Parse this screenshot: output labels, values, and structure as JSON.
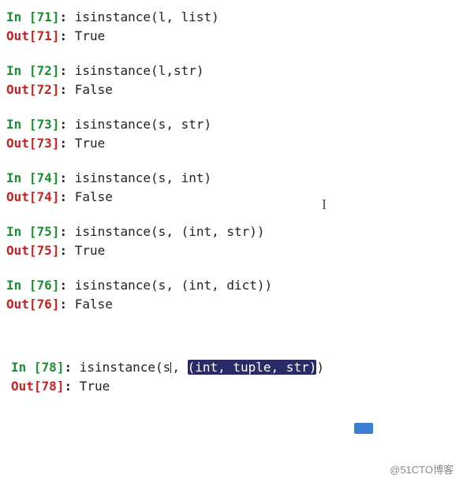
{
  "cells": [
    {
      "num": "71",
      "code": "isinstance(l, list)",
      "out": "True"
    },
    {
      "num": "72",
      "code": "isinstance(l,str)",
      "out": "False"
    },
    {
      "num": "73",
      "code": "isinstance(s, str)",
      "out": "True"
    },
    {
      "num": "74",
      "code": "isinstance(s, int)",
      "out": "False"
    },
    {
      "num": "75",
      "code": "isinstance(s, (int, str))",
      "out": "True"
    },
    {
      "num": "76",
      "code": "isinstance(s, (int, dict))",
      "out": "False"
    }
  ],
  "cell78": {
    "num": "78",
    "code_prefix": "isinstance(s",
    "code_between": ", ",
    "code_highlight": "(int, tuple, str)",
    "code_suffix": ")",
    "out": "True"
  },
  "prompts": {
    "in_word": "In ",
    "out_word": "Out",
    "lb": "[",
    "rb": "]",
    "colon_sp": ": "
  },
  "watermark": "@51CTO博客"
}
